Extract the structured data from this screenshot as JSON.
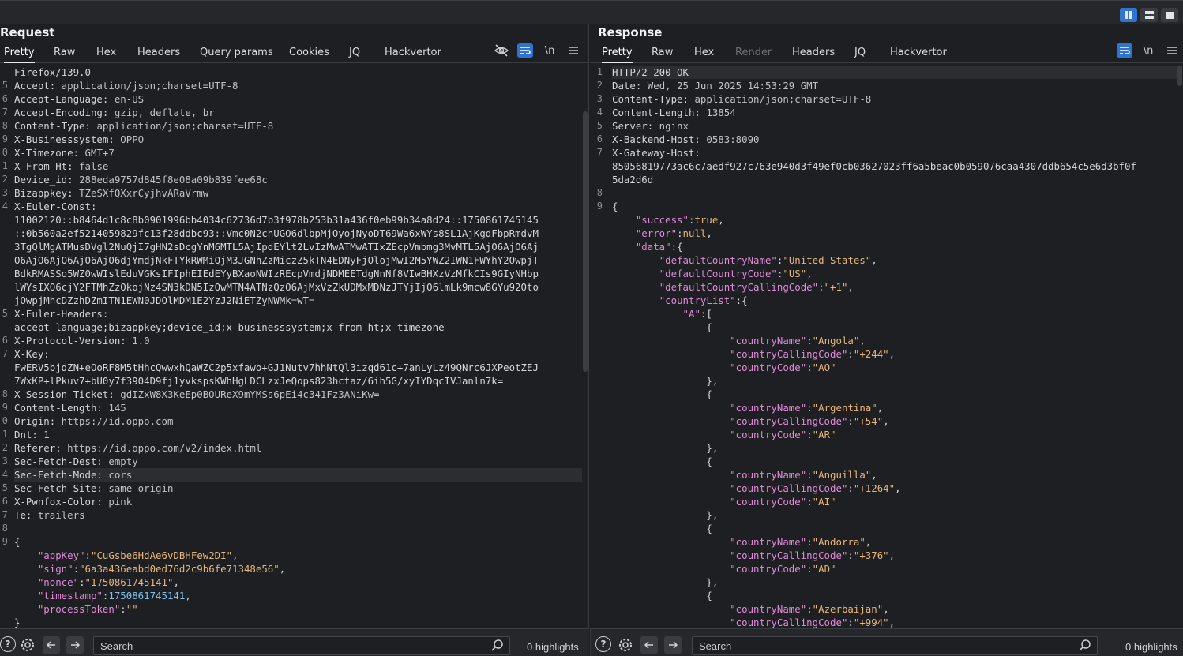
{
  "layout_buttons": [
    {
      "name": "split-horizontal-icon",
      "active": true
    },
    {
      "name": "split-vertical-icon",
      "active": false
    },
    {
      "name": "single-pane-icon",
      "active": false
    }
  ],
  "request": {
    "title": "Request",
    "tabs": [
      "Pretty",
      "Raw",
      "Hex",
      "Headers",
      "Query params",
      "Cookies",
      "JQ",
      "Hackvertor"
    ],
    "active_tab": "Pretty",
    "newline_label": "\\n",
    "lines": [
      {
        "n": "",
        "text": "Firefox/139.0"
      },
      {
        "n": "5",
        "key": "Accept:",
        "val": " application/json;charset=UTF-8"
      },
      {
        "n": "6",
        "key": "Accept-Language:",
        "val": " en-US"
      },
      {
        "n": "7",
        "key": "Accept-Encoding:",
        "val": " gzip, deflate, br"
      },
      {
        "n": "8",
        "key": "Content-Type:",
        "val": " application/json;charset=UTF-8"
      },
      {
        "n": "9",
        "key": "X-Businesssystem:",
        "val": " OPPO"
      },
      {
        "n": "0",
        "key": "X-Timezone:",
        "val": " GMT+7"
      },
      {
        "n": "1",
        "key": "X-From-Ht:",
        "val": " false"
      },
      {
        "n": "2",
        "key": "Device_id:",
        "val": " 288eda9757d845f8e08a09b839fee68c"
      },
      {
        "n": "3",
        "key": "Bizappkey:",
        "val": " TZeSXfQXxrCyjhvARaVrmw"
      },
      {
        "n": "4",
        "key": "X-Euler-Const:",
        "val": ""
      },
      {
        "n": "",
        "text": "11002120::b8464d1c8c8b0901996bb4034c62736d7b3f978b253b31a436f0eb99b34a8d24::1750861745145"
      },
      {
        "n": "",
        "text": "::0b560a2ef5214059829fc13f28ddbc93::Vmc0N2chUGO6dlbpMjOyojNyoDT69Wa6xWYs8SL1AjKgdFbpRmdvM"
      },
      {
        "n": "",
        "text": "3TgQlMgATMusDVgl2NuQjI7gHN2sDcgYnM6MTL5AjIpdEYlt2LvIzMwATMwATIxZEcpVmbmg3MvMTL5AjO6AjO6Aj"
      },
      {
        "n": "",
        "text": "O6AjO6AjO6AjO6AjO6djYmdjNkFTYkRWMiQjM3JGNhZzMiczZ5kTN4EDNyFjOlojMwI2M5YWZ2IWN1FWYhY2OwpjT"
      },
      {
        "n": "",
        "text": "BdkRMASSo5WZ0wWIslEduVGKsIFIphEIEdEYyBXaoNWIzREcpVmdjNDMEETdgNnNf8VIwBHXzVzMfkCIs9GIyNHbp"
      },
      {
        "n": "",
        "text": "lWYsIXO6cjY2FTMhZzOkojNz4SN3kDN5IzOwMTN4ATNzQzO6AjMxVzZkUDMxMDNzJTYjIjO6lmLk9mcw8GYu92Oto"
      },
      {
        "n": "",
        "text": "jOwpjMhcDZzhDZmITN1EWN0JDOlMDM1E2YzJ2NiETZyNWMk=wT="
      },
      {
        "n": "5",
        "key": "X-Euler-Headers:",
        "val": ""
      },
      {
        "n": "",
        "text": "accept-language;bizappkey;device_id;x-businesssystem;x-from-ht;x-timezone"
      },
      {
        "n": "6",
        "key": "X-Protocol-Version:",
        "val": " 1.0"
      },
      {
        "n": "7",
        "key": "X-Key:",
        "val": ""
      },
      {
        "n": "",
        "text": "FwERV5bjdZN+eOoRF8M5tHhcQwwxhQaWZC2p5xfawo+GJ1Nutv7hhNtQl3izqd61c+7anLyLz49QNrc6JXPeotZEJ"
      },
      {
        "n": "",
        "text": "7WxKP+lPkuv7+bU0y7f3904D9fj1yvkspsKWhHgLDCLzxJeQops823hctaz/6ih5G/xyIYDqcIVJanln7k="
      },
      {
        "n": "8",
        "key": "X-Session-Ticket:",
        "val": " gdIZxW8X3KeEp0BOUReX9mYMSs6pEi4c341Fz3ANiKw="
      },
      {
        "n": "9",
        "key": "Content-Length:",
        "val": " 145"
      },
      {
        "n": "0",
        "key": "Origin:",
        "val": " https://id.oppo.com"
      },
      {
        "n": "1",
        "key": "Dnt:",
        "val": " 1"
      },
      {
        "n": "2",
        "key": "Referer:",
        "val": " https://id.oppo.com/v2/index.html"
      },
      {
        "n": "3",
        "key": "Sec-Fetch-Dest:",
        "val": " empty"
      },
      {
        "n": "4",
        "key": "Sec-Fetch-Mode:",
        "val": " cors",
        "hl": true
      },
      {
        "n": "5",
        "key": "Sec-Fetch-Site:",
        "val": " same-origin"
      },
      {
        "n": "6",
        "key": "X-Pwnfox-Color:",
        "val": " pink"
      },
      {
        "n": "7",
        "key": "Te:",
        "val": " trailers"
      },
      {
        "n": "8",
        "text": ""
      },
      {
        "n": "9",
        "text": "{"
      },
      {
        "n": "",
        "json": [
          [
            "p",
            "    "
          ],
          [
            "jk",
            "\"appKey\""
          ],
          [
            "p",
            ":"
          ],
          [
            "js",
            "\"CuGsbe6HdAe6vDBHFew2DI\""
          ],
          [
            "p",
            ","
          ]
        ]
      },
      {
        "n": "",
        "json": [
          [
            "p",
            "    "
          ],
          [
            "jk",
            "\"sign\""
          ],
          [
            "p",
            ":"
          ],
          [
            "js",
            "\"6a3a436eabd0ed76d2c9b6fe71348e56\""
          ],
          [
            "p",
            ","
          ]
        ]
      },
      {
        "n": "",
        "json": [
          [
            "p",
            "    "
          ],
          [
            "jk",
            "\"nonce\""
          ],
          [
            "p",
            ":"
          ],
          [
            "js",
            "\"1750861745141\""
          ],
          [
            "p",
            ","
          ]
        ]
      },
      {
        "n": "",
        "json": [
          [
            "p",
            "    "
          ],
          [
            "jk",
            "\"timestamp\""
          ],
          [
            "p",
            ":"
          ],
          [
            "jn",
            "1750861745141"
          ],
          [
            "p",
            ","
          ]
        ]
      },
      {
        "n": "",
        "json": [
          [
            "p",
            "    "
          ],
          [
            "jk",
            "\"processToken\""
          ],
          [
            "p",
            ":"
          ],
          [
            "js",
            "\"\""
          ]
        ]
      },
      {
        "n": "",
        "text": "}"
      }
    ]
  },
  "response": {
    "title": "Response",
    "tabs": [
      "Pretty",
      "Raw",
      "Hex",
      "Render",
      "Headers",
      "JQ",
      "Hackvertor"
    ],
    "disabled_tabs": [
      "Render"
    ],
    "active_tab": "Pretty",
    "newline_label": "\\n",
    "lines": [
      {
        "n": "1",
        "text": "HTTP/2 200 OK",
        "hl": true
      },
      {
        "n": "2",
        "key": "Date:",
        "val": " Wed, 25 Jun 2025 14:53:29 GMT"
      },
      {
        "n": "3",
        "key": "Content-Type:",
        "val": " application/json;charset=UTF-8"
      },
      {
        "n": "4",
        "key": "Content-Length:",
        "val": " 13854"
      },
      {
        "n": "5",
        "key": "Server:",
        "val": " nginx"
      },
      {
        "n": "6",
        "key": "X-Backend-Host:",
        "val": " 0583:8090"
      },
      {
        "n": "7",
        "key": "X-Gateway-Host:",
        "val": ""
      },
      {
        "n": "",
        "text": "85056819773ac6c7aedf927c763e940d3f49ef0cb03627023ff6a5beac0b059076caa4307ddb654c5e6d3bf0f"
      },
      {
        "n": "",
        "text": "5da2d6d"
      },
      {
        "n": "8",
        "text": ""
      },
      {
        "n": "9",
        "text": "{"
      },
      {
        "n": "",
        "json": [
          [
            "p",
            "    "
          ],
          [
            "jk",
            "\"success\""
          ],
          [
            "p",
            ":"
          ],
          [
            "jb",
            "true"
          ],
          [
            "p",
            ","
          ]
        ]
      },
      {
        "n": "",
        "json": [
          [
            "p",
            "    "
          ],
          [
            "jk",
            "\"error\""
          ],
          [
            "p",
            ":"
          ],
          [
            "jb",
            "null"
          ],
          [
            "p",
            ","
          ]
        ]
      },
      {
        "n": "",
        "json": [
          [
            "p",
            "    "
          ],
          [
            "jk",
            "\"data\""
          ],
          [
            "p",
            ":{"
          ]
        ]
      },
      {
        "n": "",
        "json": [
          [
            "p",
            "        "
          ],
          [
            "jk",
            "\"defaultCountryName\""
          ],
          [
            "p",
            ":"
          ],
          [
            "js",
            "\"United States\""
          ],
          [
            "p",
            ","
          ]
        ]
      },
      {
        "n": "",
        "json": [
          [
            "p",
            "        "
          ],
          [
            "jk",
            "\"defaultCountryCode\""
          ],
          [
            "p",
            ":"
          ],
          [
            "js",
            "\"US\""
          ],
          [
            "p",
            ","
          ]
        ]
      },
      {
        "n": "",
        "json": [
          [
            "p",
            "        "
          ],
          [
            "jk",
            "\"defaultCountryCallingCode\""
          ],
          [
            "p",
            ":"
          ],
          [
            "js",
            "\"+1\""
          ],
          [
            "p",
            ","
          ]
        ]
      },
      {
        "n": "",
        "json": [
          [
            "p",
            "        "
          ],
          [
            "jk",
            "\"countryList\""
          ],
          [
            "p",
            ":{"
          ]
        ]
      },
      {
        "n": "",
        "json": [
          [
            "p",
            "            "
          ],
          [
            "jk",
            "\"A\""
          ],
          [
            "p",
            ":["
          ]
        ]
      },
      {
        "n": "",
        "json": [
          [
            "p",
            "                {"
          ]
        ]
      },
      {
        "n": "",
        "json": [
          [
            "p",
            "                    "
          ],
          [
            "jk",
            "\"countryName\""
          ],
          [
            "p",
            ":"
          ],
          [
            "js",
            "\"Angola\""
          ],
          [
            "p",
            ","
          ]
        ]
      },
      {
        "n": "",
        "json": [
          [
            "p",
            "                    "
          ],
          [
            "jk",
            "\"countryCallingCode\""
          ],
          [
            "p",
            ":"
          ],
          [
            "js",
            "\"+244\""
          ],
          [
            "p",
            ","
          ]
        ]
      },
      {
        "n": "",
        "json": [
          [
            "p",
            "                    "
          ],
          [
            "jk",
            "\"countryCode\""
          ],
          [
            "p",
            ":"
          ],
          [
            "js",
            "\"AO\""
          ]
        ]
      },
      {
        "n": "",
        "json": [
          [
            "p",
            "                },"
          ]
        ]
      },
      {
        "n": "",
        "json": [
          [
            "p",
            "                {"
          ]
        ]
      },
      {
        "n": "",
        "json": [
          [
            "p",
            "                    "
          ],
          [
            "jk",
            "\"countryName\""
          ],
          [
            "p",
            ":"
          ],
          [
            "js",
            "\"Argentina\""
          ],
          [
            "p",
            ","
          ]
        ]
      },
      {
        "n": "",
        "json": [
          [
            "p",
            "                    "
          ],
          [
            "jk",
            "\"countryCallingCode\""
          ],
          [
            "p",
            ":"
          ],
          [
            "js",
            "\"+54\""
          ],
          [
            "p",
            ","
          ]
        ]
      },
      {
        "n": "",
        "json": [
          [
            "p",
            "                    "
          ],
          [
            "jk",
            "\"countryCode\""
          ],
          [
            "p",
            ":"
          ],
          [
            "js",
            "\"AR\""
          ]
        ]
      },
      {
        "n": "",
        "json": [
          [
            "p",
            "                },"
          ]
        ]
      },
      {
        "n": "",
        "json": [
          [
            "p",
            "                {"
          ]
        ]
      },
      {
        "n": "",
        "json": [
          [
            "p",
            "                    "
          ],
          [
            "jk",
            "\"countryName\""
          ],
          [
            "p",
            ":"
          ],
          [
            "js",
            "\"Anguilla\""
          ],
          [
            "p",
            ","
          ]
        ]
      },
      {
        "n": "",
        "json": [
          [
            "p",
            "                    "
          ],
          [
            "jk",
            "\"countryCallingCode\""
          ],
          [
            "p",
            ":"
          ],
          [
            "js",
            "\"+1264\""
          ],
          [
            "p",
            ","
          ]
        ]
      },
      {
        "n": "",
        "json": [
          [
            "p",
            "                    "
          ],
          [
            "jk",
            "\"countryCode\""
          ],
          [
            "p",
            ":"
          ],
          [
            "js",
            "\"AI\""
          ]
        ]
      },
      {
        "n": "",
        "json": [
          [
            "p",
            "                },"
          ]
        ]
      },
      {
        "n": "",
        "json": [
          [
            "p",
            "                {"
          ]
        ]
      },
      {
        "n": "",
        "json": [
          [
            "p",
            "                    "
          ],
          [
            "jk",
            "\"countryName\""
          ],
          [
            "p",
            ":"
          ],
          [
            "js",
            "\"Andorra\""
          ],
          [
            "p",
            ","
          ]
        ]
      },
      {
        "n": "",
        "json": [
          [
            "p",
            "                    "
          ],
          [
            "jk",
            "\"countryCallingCode\""
          ],
          [
            "p",
            ":"
          ],
          [
            "js",
            "\"+376\""
          ],
          [
            "p",
            ","
          ]
        ]
      },
      {
        "n": "",
        "json": [
          [
            "p",
            "                    "
          ],
          [
            "jk",
            "\"countryCode\""
          ],
          [
            "p",
            ":"
          ],
          [
            "js",
            "\"AD\""
          ]
        ]
      },
      {
        "n": "",
        "json": [
          [
            "p",
            "                },"
          ]
        ]
      },
      {
        "n": "",
        "json": [
          [
            "p",
            "                {"
          ]
        ]
      },
      {
        "n": "",
        "json": [
          [
            "p",
            "                    "
          ],
          [
            "jk",
            "\"countryName\""
          ],
          [
            "p",
            ":"
          ],
          [
            "js",
            "\"Azerbaijan\""
          ],
          [
            "p",
            ","
          ]
        ]
      },
      {
        "n": "",
        "json": [
          [
            "p",
            "                    "
          ],
          [
            "jk",
            "\"countryCallingCode\""
          ],
          [
            "p",
            ":"
          ],
          [
            "js",
            "\"+994\""
          ],
          [
            "p",
            ","
          ]
        ]
      }
    ]
  },
  "bottom": {
    "left": {
      "search_placeholder": "Search",
      "highlights": "0 highlights"
    },
    "right": {
      "search_placeholder": "Search",
      "highlights": "0 highlights"
    }
  },
  "icons": {
    "help": "help-icon",
    "settings": "gear-icon",
    "back": "arrow-left-icon",
    "forward": "arrow-right-icon",
    "search": "magnifier-icon",
    "hide": "eye-slash-icon",
    "wrap": "word-wrap-icon",
    "menu": "hamburger-menu-icon"
  }
}
